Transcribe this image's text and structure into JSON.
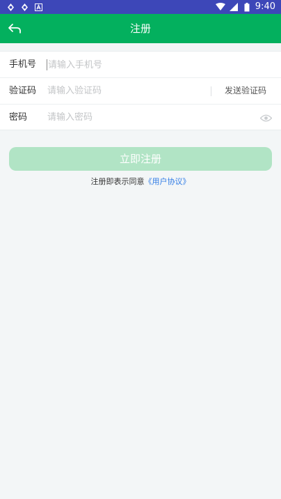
{
  "status_bar": {
    "time": "9:40",
    "left_icons": [
      "sync-icon",
      "sync-icon",
      "text-a-icon"
    ],
    "right_icons": [
      "wifi-icon",
      "signal-icon",
      "battery-icon"
    ]
  },
  "header": {
    "title": "注册",
    "back_icon": "back-arrow-icon"
  },
  "form": {
    "phone": {
      "label": "手机号",
      "placeholder": "请输入手机号",
      "value": ""
    },
    "code": {
      "label": "验证码",
      "placeholder": "请输入验证码",
      "value": "",
      "send_label": "发送验证码"
    },
    "password": {
      "label": "密码",
      "placeholder": "请输入密码",
      "value": "",
      "toggle_icon": "eye-icon"
    }
  },
  "actions": {
    "register_label": "立即注册"
  },
  "agreement": {
    "prefix": "注册即表示同意",
    "link": "《用户协议》"
  },
  "colors": {
    "status_bar": "#3d47b8",
    "header": "#03b05e",
    "button_disabled": "#b1e4c5",
    "link": "#2f7be5",
    "background": "#f3f6f7"
  }
}
